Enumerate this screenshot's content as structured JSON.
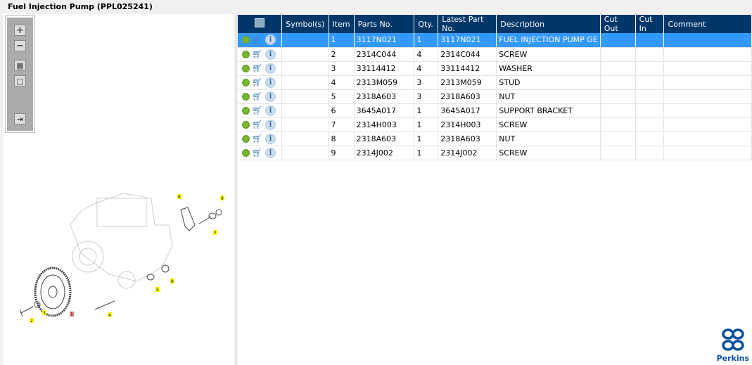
{
  "title": "Fuel Injection Pump (PPL025241)",
  "toolbar": {
    "zoom_in": "+",
    "zoom_out": "−",
    "fit": "▦",
    "actual": "□",
    "export": "⇥"
  },
  "table": {
    "headers": [
      "Symbol(s)",
      "Item",
      "Parts No.",
      "Qty.",
      "Latest Part No.",
      "Description",
      "Cut Out",
      "Cut In",
      "Comment"
    ],
    "rows": [
      {
        "symbols": "",
        "item": "1",
        "part": "3117N021",
        "qty": "1",
        "latest": "3117N021",
        "desc": "FUEL INJECTION PUMP GE",
        "cutout": "",
        "cutin": "",
        "comment": ""
      },
      {
        "symbols": "",
        "item": "2",
        "part": "2314C044",
        "qty": "4",
        "latest": "2314C044",
        "desc": "SCREW",
        "cutout": "",
        "cutin": "",
        "comment": ""
      },
      {
        "symbols": "",
        "item": "3",
        "part": "33114412",
        "qty": "4",
        "latest": "33114412",
        "desc": "WASHER",
        "cutout": "",
        "cutin": "",
        "comment": ""
      },
      {
        "symbols": "",
        "item": "4",
        "part": "2313M059",
        "qty": "3",
        "latest": "2313M059",
        "desc": "STUD",
        "cutout": "",
        "cutin": "",
        "comment": ""
      },
      {
        "symbols": "",
        "item": "5",
        "part": "2318A603",
        "qty": "3",
        "latest": "2318A603",
        "desc": "NUT",
        "cutout": "",
        "cutin": "",
        "comment": ""
      },
      {
        "symbols": "",
        "item": "6",
        "part": "3645A017",
        "qty": "1",
        "latest": "3645A017",
        "desc": "SUPPORT BRACKET",
        "cutout": "",
        "cutin": "",
        "comment": ""
      },
      {
        "symbols": "",
        "item": "7",
        "part": "2314H003",
        "qty": "1",
        "latest": "2314H003",
        "desc": "SCREW",
        "cutout": "",
        "cutin": "",
        "comment": ""
      },
      {
        "symbols": "",
        "item": "8",
        "part": "2318A603",
        "qty": "1",
        "latest": "2318A603",
        "desc": "NUT",
        "cutout": "",
        "cutin": "",
        "comment": ""
      },
      {
        "symbols": "",
        "item": "9",
        "part": "2314J002",
        "qty": "1",
        "latest": "2314J002",
        "desc": "SCREW",
        "cutout": "",
        "cutin": "",
        "comment": ""
      }
    ],
    "selected_row": 0
  },
  "diagram": {
    "callouts": [
      "1",
      "2",
      "3",
      "4",
      "5",
      "6",
      "7",
      "8",
      "9"
    ]
  },
  "logo": {
    "text": "Perkins"
  },
  "colors": {
    "header": "#003769",
    "selected": "#3399ff"
  }
}
